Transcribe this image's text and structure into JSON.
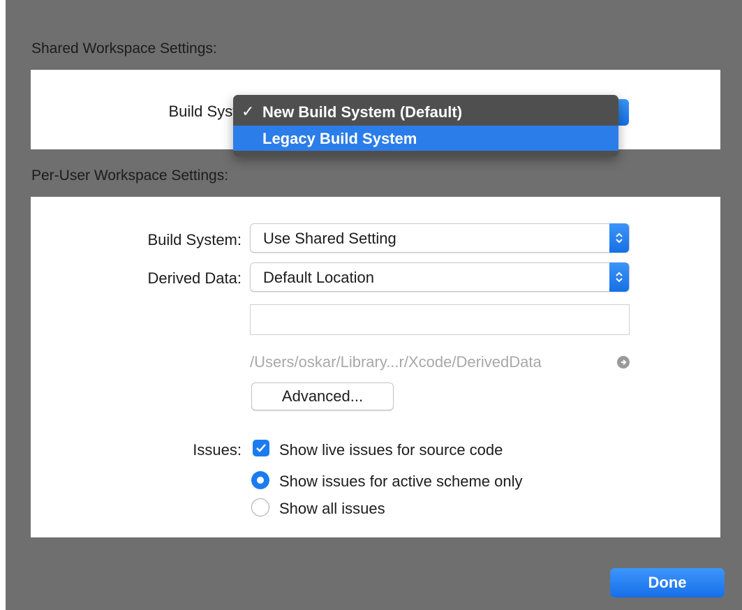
{
  "shared_section": {
    "title": "Shared Workspace Settings:",
    "build_system_label": "Build System:",
    "menu": {
      "items": [
        {
          "label": "New Build System (Default)",
          "checked": true,
          "highlighted": false
        },
        {
          "label": "Legacy Build System",
          "checked": false,
          "highlighted": true
        }
      ],
      "check_glyph": "✓"
    }
  },
  "per_user_section": {
    "title": "Per-User Workspace Settings:",
    "build_system": {
      "label": "Build System:",
      "value": "Use Shared Setting"
    },
    "derived_data": {
      "label": "Derived Data:",
      "value": "Default Location",
      "custom_path_value": "",
      "resolved_path": "/Users/oskar/Library...r/Xcode/DerivedData"
    },
    "advanced_button": "Advanced...",
    "issues": {
      "label": "Issues:",
      "live_issues": {
        "label": "Show live issues for source code",
        "checked": true
      },
      "scheme_options": [
        {
          "label": "Show issues for active scheme only",
          "selected": true
        },
        {
          "label": "Show all issues",
          "selected": false
        }
      ]
    }
  },
  "done_button": "Done",
  "colors": {
    "accent": "#1a7cf0",
    "sheet_background": "#6f6f6f",
    "menu_background": "#4f4f4f",
    "menu_highlight": "#2b7de9"
  },
  "icons": {
    "popup_stepper": "up-down-chevron-icon",
    "path_reveal": "arrow-circle-right-icon",
    "checkbox_check": "checkmark-icon"
  }
}
